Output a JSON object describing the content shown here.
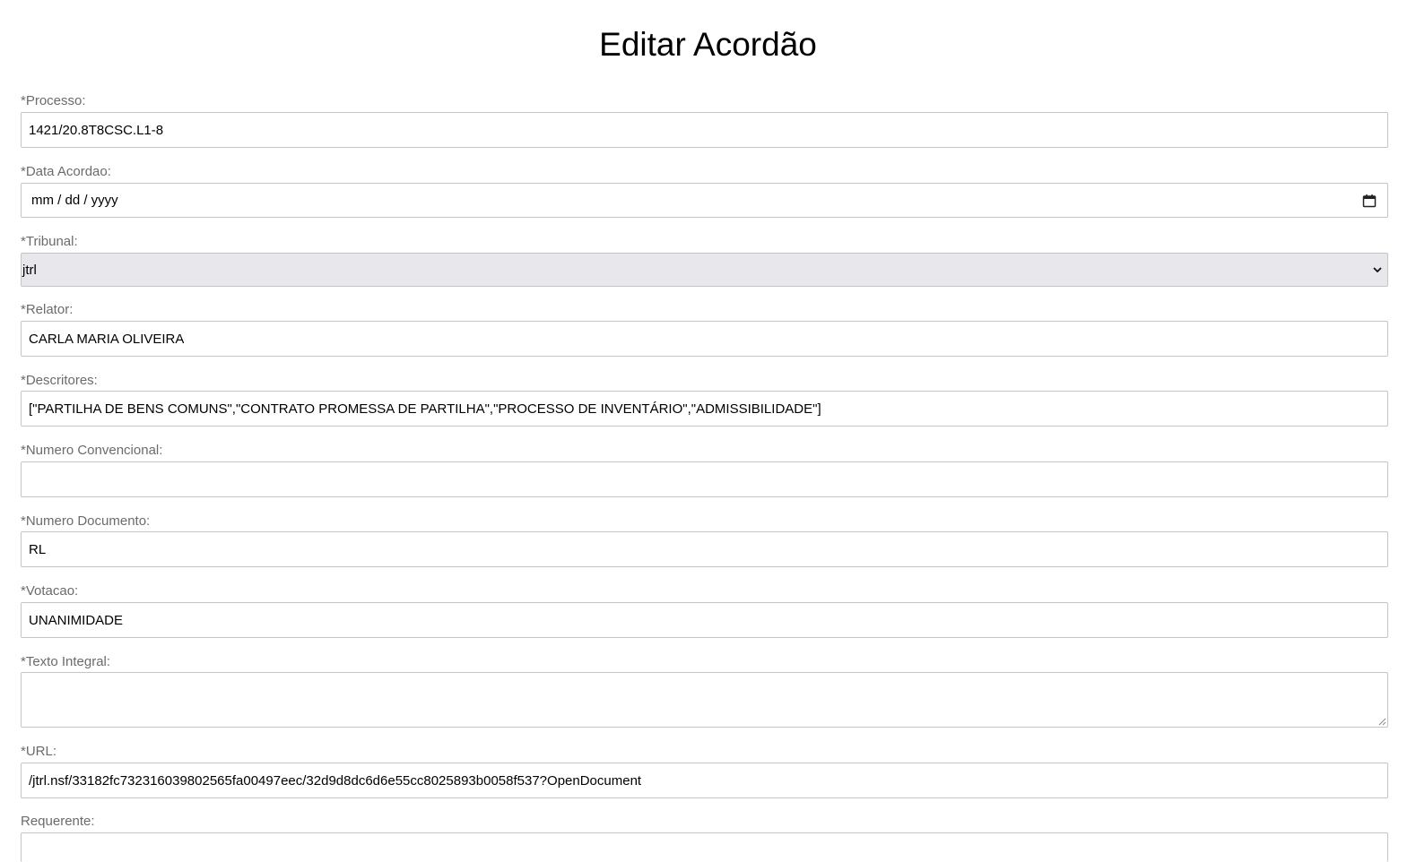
{
  "page": {
    "title": "Editar Acordão"
  },
  "form": {
    "processo": {
      "label": "*Processo:",
      "value": "1421/20.8T8CSC.L1-8"
    },
    "data_acordao": {
      "label": "*Data Acordao:",
      "value": "mm / dd / yyyy"
    },
    "tribunal": {
      "label": "*Tribunal:",
      "selected": "jtrl"
    },
    "relator": {
      "label": "*Relator:",
      "value": "CARLA MARIA OLIVEIRA"
    },
    "descritores": {
      "label": "*Descritores:",
      "value": "[\"PARTILHA DE BENS COMUNS\",\"CONTRATO PROMESSA DE PARTILHA\",\"PROCESSO DE INVENTÁRIO\",\"ADMISSIBILIDADE\"]"
    },
    "numero_convencional": {
      "label": "*Numero Convencional:",
      "value": ""
    },
    "numero_documento": {
      "label": "*Numero Documento:",
      "value": "RL"
    },
    "votacao": {
      "label": "*Votacao:",
      "value": "UNANIMIDADE"
    },
    "texto_integral": {
      "label": "*Texto Integral:",
      "value": ""
    },
    "url": {
      "label": "*URL:",
      "value": "/jtrl.nsf/33182fc732316039802565fa00497eec/32d9d8dc6d6e55cc8025893b0058f537?OpenDocument"
    },
    "requerente": {
      "label": "Requerente:",
      "value": ""
    }
  },
  "icons": {
    "date_picker": "calendar-icon",
    "select_arrow": "chevron-down-icon",
    "textarea_resize": "resize-handle-icon"
  }
}
